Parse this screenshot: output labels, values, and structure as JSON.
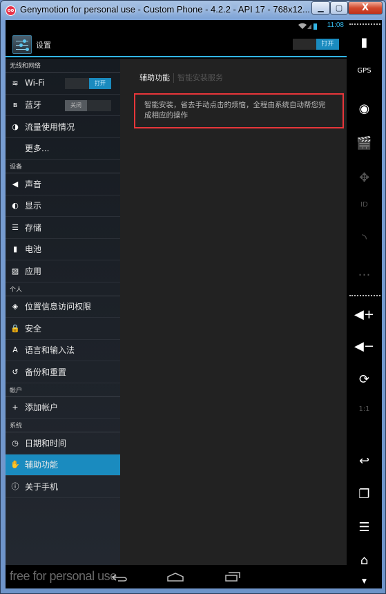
{
  "window": {
    "title": "Genymotion for personal use - Custom Phone - 4.2.2 - API 17 - 768x12...",
    "logo": "oo",
    "minimize_label": "▁",
    "maximize_label": "▢",
    "close_label": "X"
  },
  "statusbar": {
    "time": "11:08",
    "icons": [
      "wifi-icon",
      "signal-icon",
      "battery-icon"
    ]
  },
  "actionbar": {
    "title": "设置",
    "master_switch": "打开"
  },
  "sidebar": {
    "sections": [
      {
        "header": "无线和网络",
        "items": [
          {
            "icon": "wifi-icon",
            "glyph": "≋",
            "label": "Wi-Fi",
            "toggle": "打开",
            "toggle_state": "on"
          },
          {
            "icon": "bluetooth-icon",
            "glyph": "ʙ",
            "label": "蓝牙",
            "toggle": "关闭",
            "toggle_state": "off"
          },
          {
            "icon": "data-usage-icon",
            "glyph": "◑",
            "label": "流量使用情况"
          },
          {
            "icon": "",
            "glyph": "",
            "label": "更多..."
          }
        ]
      },
      {
        "header": "设备",
        "items": [
          {
            "icon": "sound-icon",
            "glyph": "◀",
            "label": "声音"
          },
          {
            "icon": "display-icon",
            "glyph": "◐",
            "label": "显示"
          },
          {
            "icon": "storage-icon",
            "glyph": "☰",
            "label": "存储"
          },
          {
            "icon": "battery-icon",
            "glyph": "▮",
            "label": "电池"
          },
          {
            "icon": "apps-icon",
            "glyph": "▨",
            "label": "应用"
          }
        ]
      },
      {
        "header": "个人",
        "items": [
          {
            "icon": "location-icon",
            "glyph": "◈",
            "label": "位置信息访问权限"
          },
          {
            "icon": "lock-icon",
            "glyph": "🔒",
            "label": "安全"
          },
          {
            "icon": "language-icon",
            "glyph": "A",
            "label": "语言和输入法"
          },
          {
            "icon": "backup-icon",
            "glyph": "↺",
            "label": "备份和重置"
          }
        ]
      },
      {
        "header": "帐户",
        "items": [
          {
            "icon": "add-icon",
            "glyph": "+",
            "label": "添加帐户"
          }
        ]
      },
      {
        "header": "系统",
        "items": [
          {
            "icon": "clock-icon",
            "glyph": "◷",
            "label": "日期和时间"
          },
          {
            "icon": "hand-icon",
            "glyph": "✋",
            "label": "辅助功能",
            "selected": true
          },
          {
            "icon": "info-icon",
            "glyph": "ⓘ",
            "label": "关于手机"
          }
        ]
      }
    ]
  },
  "content": {
    "breadcrumb": [
      "辅助功能",
      "智能安装服务"
    ],
    "description": "智能安装，省去手动点击的烦恼，全程由系统自动帮您完成相应的操作"
  },
  "navbar": {
    "watermark": "free for personal use",
    "back": "⮌",
    "home": "⌂",
    "recents": "▭"
  },
  "toolbar": [
    {
      "name": "battery-widget-button",
      "glyph": "▮",
      "dim": false
    },
    {
      "name": "gps-widget-button",
      "glyph": "GPS",
      "dim": false
    },
    {
      "name": "camera-widget-button",
      "glyph": "◉",
      "dim": false
    },
    {
      "name": "screencast-button",
      "glyph": "🎬",
      "dim": true
    },
    {
      "name": "remote-control-button",
      "glyph": "✥",
      "dim": true
    },
    {
      "name": "device-id-button",
      "glyph": "ID",
      "dim": true
    },
    {
      "name": "network-button",
      "glyph": "◝",
      "dim": true
    },
    {
      "name": "sms-button",
      "glyph": "…",
      "dim": true
    },
    {
      "name": "volume-up-button",
      "glyph": "◀+",
      "dim": false
    },
    {
      "name": "volume-down-button",
      "glyph": "◀−",
      "dim": false
    },
    {
      "name": "rotate-button",
      "glyph": "⟳",
      "dim": false
    },
    {
      "name": "pixel-perfect-button",
      "glyph": "1:1",
      "dim": true
    },
    {
      "name": "back-button",
      "glyph": "↩",
      "dim": false
    },
    {
      "name": "recent-apps-button",
      "glyph": "❐",
      "dim": false
    },
    {
      "name": "menu-button",
      "glyph": "☰",
      "dim": false
    },
    {
      "name": "home-button",
      "glyph": "⌂",
      "dim": false
    }
  ],
  "colors": {
    "accent": "#33b5e5",
    "selected": "#1a8bbf",
    "highlight_border": "#e8363a"
  }
}
